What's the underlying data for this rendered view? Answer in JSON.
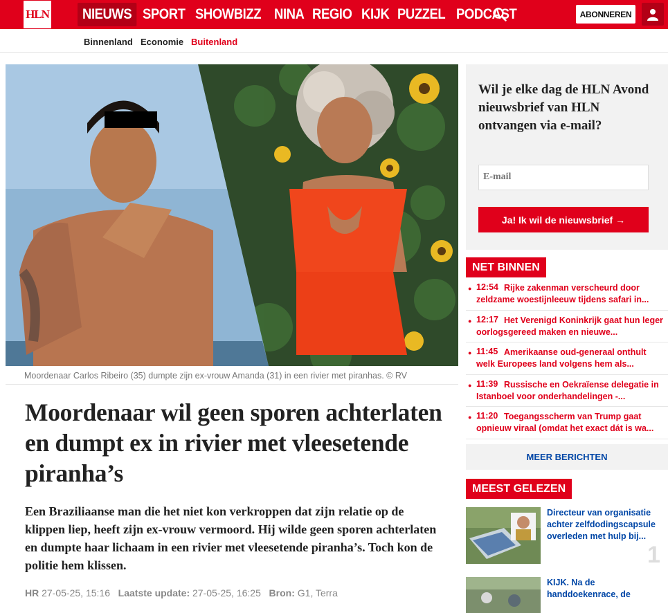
{
  "header": {
    "logo": "HLN",
    "nav": [
      "NIEUWS",
      "SPORT",
      "SHOWBIZZ",
      "NINA",
      "REGIO",
      "KIJK",
      "PUZZEL",
      "PODCAST"
    ],
    "subscribe": "ABONNEREN"
  },
  "subnav": [
    "Binnenland",
    "Economie",
    "Buitenland"
  ],
  "article": {
    "caption": "Moordenaar Carlos Ribeiro (35) dumpte zijn ex-vrouw Amanda (31) in een rivier met piranhas. © RV",
    "headline": "Moordenaar wil geen sporen achterlaten en dumpt ex in rivier met vleesetende piranha’s",
    "lead": "Een Braziliaanse man die het niet kon verkroppen dat zijn relatie op de klippen liep, heeft zijn ex-vrouw vermoord. Hij wilde geen sporen achterlaten en dumpte haar lichaam in een rivier met vleesetende piranha’s. Toch kon de politie hem klissen.",
    "meta": {
      "author_label": "HR",
      "published": "27-05-25, 15:16",
      "update_label": "Laatste update:",
      "updated": "27-05-25, 16:25",
      "source_label": "Bron:",
      "source": "G1, Terra"
    }
  },
  "newsletter": {
    "title": "Wil je elke dag de HLN Avond nieuwsbrief van HLN ontvangen via e-mail?",
    "placeholder": "E-mail",
    "button": "Ja! Ik wil de nieuwsbrief →"
  },
  "net_binnen": {
    "label": "NET BINNEN",
    "items": [
      {
        "time": "12:54",
        "text": "Rijke zakenman verscheurd door zeldzame woestijnleeuw tijdens safari in..."
      },
      {
        "time": "12:17",
        "text": "Het Verenigd Koninkrijk gaat hun leger oorlogsgereed maken en nieuwe..."
      },
      {
        "time": "11:45",
        "text": "Amerikaanse oud-generaal onthult welk Europees land volgens hem als..."
      },
      {
        "time": "11:39",
        "text": "Russische en Oekraïense delegatie in Istanboel voor onderhandelingen -..."
      },
      {
        "time": "11:20",
        "text": "Toegangsscherm van Trump gaat opnieuw viraal (omdat het exact dát is wa..."
      }
    ],
    "more": "MEER BERICHTEN"
  },
  "meest_gelezen": {
    "label": "MEEST GELEZEN",
    "items": [
      {
        "text": "Directeur van organisatie achter zelfdodingscapsule overleden met hulp bij...",
        "rank": "1"
      },
      {
        "text": "KIJK. Na de handdoekenrace, de"
      }
    ]
  },
  "colors": {
    "brand": "#e0001b",
    "link": "#0046a6"
  }
}
